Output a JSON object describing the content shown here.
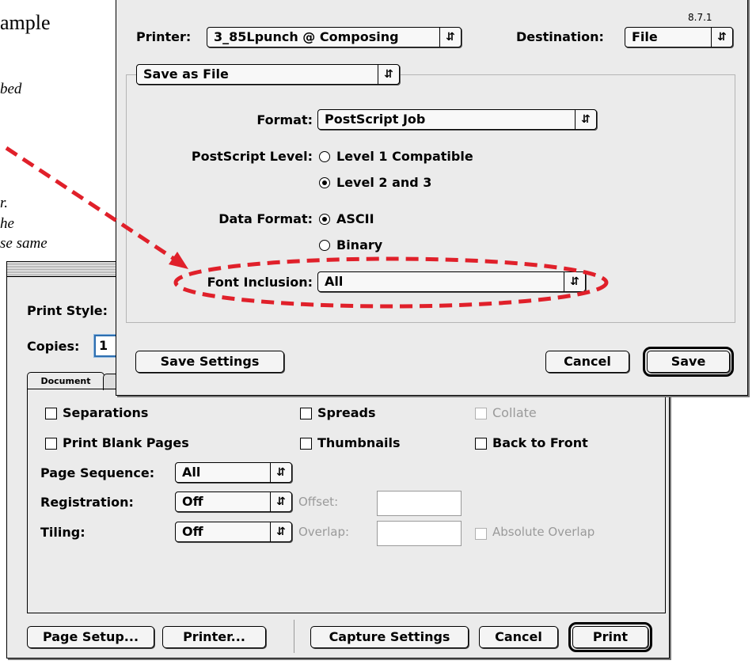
{
  "background_doc": {
    "title_fragment": "ample",
    "italic_lines": [
      "bed",
      "r.",
      "he",
      "se same"
    ]
  },
  "print_dialog": {
    "print_style_label": "Print Style:",
    "copies_label": "Copies:",
    "copies_value": "1",
    "tab_document": "Document",
    "checkboxes": {
      "separations": "Separations",
      "spreads": "Spreads",
      "collate": "Collate",
      "print_blank_pages": "Print Blank Pages",
      "thumbnails": "Thumbnails",
      "back_to_front": "Back to Front",
      "absolute_overlap": "Absolute Overlap"
    },
    "page_sequence_label": "Page Sequence:",
    "page_sequence_value": "All",
    "registration_label": "Registration:",
    "registration_value": "Off",
    "offset_label": "Offset:",
    "tiling_label": "Tiling:",
    "tiling_value": "Off",
    "overlap_label": "Overlap:",
    "buttons": {
      "page_setup": "Page Setup...",
      "printer": "Printer...",
      "capture_settings": "Capture Settings",
      "cancel": "Cancel",
      "print": "Print"
    }
  },
  "printer_dialog": {
    "version": "8.7.1",
    "printer_label": "Printer:",
    "printer_value": "3_85Lpunch @ Composing",
    "destination_label": "Destination:",
    "destination_value": "File",
    "panel_value": "Save as File",
    "format_label": "Format:",
    "format_value": "PostScript Job",
    "postscript_level_label": "PostScript Level:",
    "level1": "Level 1 Compatible",
    "level2": "Level 2 and 3",
    "data_format_label": "Data Format:",
    "ascii": "ASCII",
    "binary": "Binary",
    "font_inclusion_label": "Font Inclusion:",
    "font_inclusion_value": "All",
    "buttons": {
      "save_settings": "Save Settings",
      "cancel": "Cancel",
      "save": "Save"
    }
  },
  "arrow_icon": "updown-arrows-icon",
  "annotation_color": "#e0202a"
}
